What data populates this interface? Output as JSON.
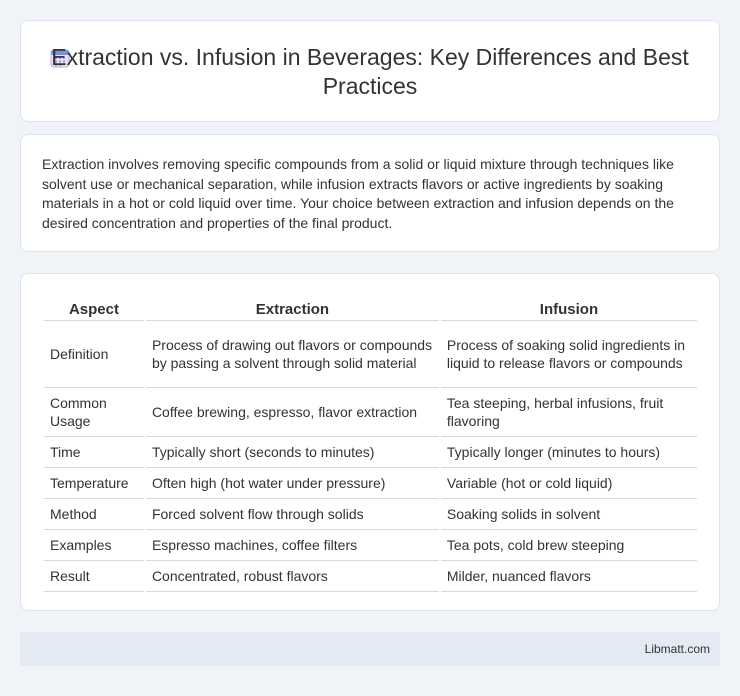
{
  "header": {
    "title": "Extraction vs. Infusion in Beverages: Key Differences and Best Practices",
    "icon": "calendar-icon"
  },
  "intro": {
    "text": "Extraction involves removing specific compounds from a solid or liquid mixture through techniques like solvent use or mechanical separation, while infusion extracts flavors or active ingredients by soaking materials in a hot or cold liquid over time. Your choice between extraction and infusion depends on the desired concentration and properties of the final product."
  },
  "table": {
    "headers": [
      "Aspect",
      "Extraction",
      "Infusion"
    ],
    "rows": [
      [
        "Definition",
        "Process of drawing out flavors or compounds by passing a solvent through solid material",
        "Process of soaking solid ingredients in liquid to release flavors or compounds"
      ],
      [
        "Common Usage",
        "Coffee brewing, espresso, flavor extraction",
        "Tea steeping, herbal infusions, fruit flavoring"
      ],
      [
        "Time",
        "Typically short (seconds to minutes)",
        "Typically longer (minutes to hours)"
      ],
      [
        "Temperature",
        "Often high (hot water under pressure)",
        "Variable (hot or cold liquid)"
      ],
      [
        "Method",
        "Forced solvent flow through solids",
        "Soaking solids in solvent"
      ],
      [
        "Examples",
        "Espresso machines, coffee filters",
        "Tea pots, cold brew steeping"
      ],
      [
        "Result",
        "Concentrated, robust flavors",
        "Milder, nuanced flavors"
      ]
    ]
  },
  "footer": {
    "site": "Libmatt.com"
  }
}
